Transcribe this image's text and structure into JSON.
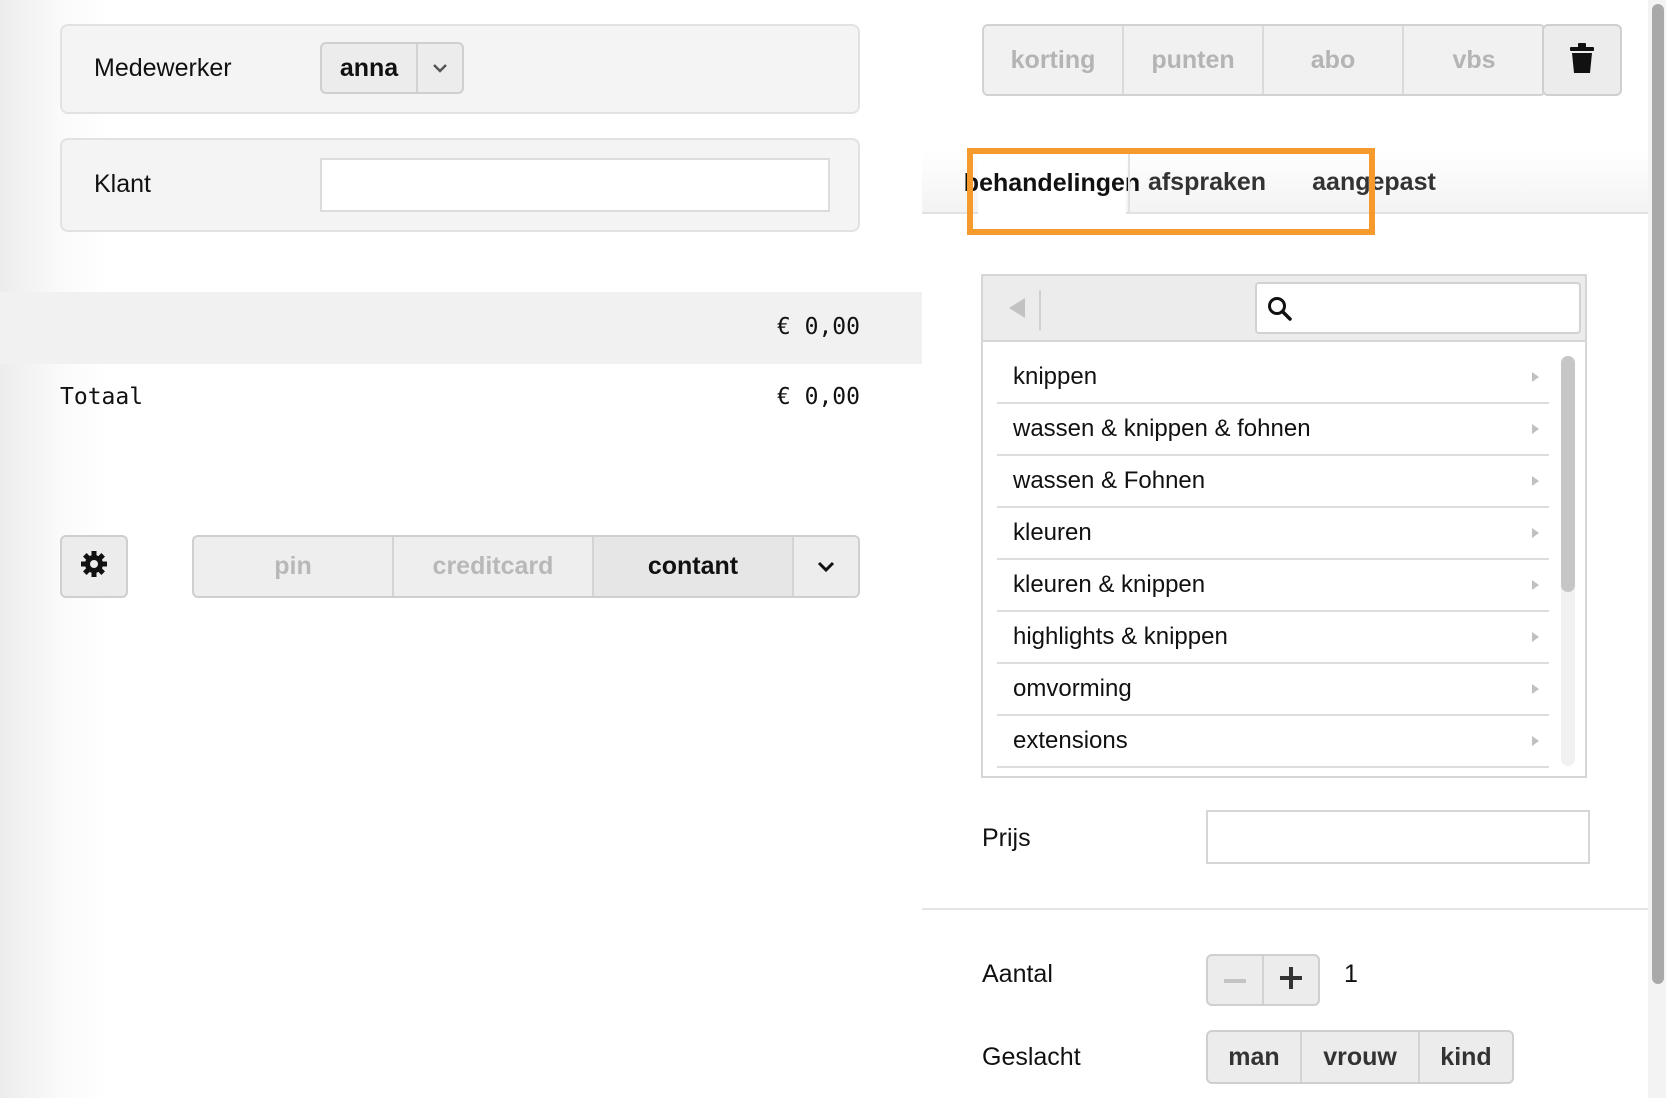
{
  "employee": {
    "label": "Medewerker",
    "value": "anna"
  },
  "customer": {
    "label": "Klant",
    "value": "",
    "placeholder": ""
  },
  "subtotal": {
    "value": "€ 0,00"
  },
  "total": {
    "label": "Totaal",
    "value": "€ 0,00"
  },
  "payment": {
    "options": [
      "pin",
      "creditcard",
      "contant"
    ],
    "selected": "contant"
  },
  "adjustments": {
    "options": [
      "korting",
      "punten",
      "abo",
      "vbs"
    ]
  },
  "tabs": [
    {
      "label": "behandelingen",
      "active": true
    },
    {
      "label": "afspraken",
      "active": false
    },
    {
      "label": "aangepast",
      "active": false
    }
  ],
  "search": {
    "value": "",
    "placeholder": ""
  },
  "treatments": [
    "knippen",
    "wassen & knippen & fohnen",
    "wassen & Fohnen",
    "kleuren",
    "kleuren & knippen",
    "highlights & knippen",
    "omvorming",
    "extensions"
  ],
  "price": {
    "label": "Prijs",
    "value": ""
  },
  "quantity": {
    "label": "Aantal",
    "value": "1"
  },
  "gender": {
    "label": "Geslacht",
    "options": [
      "man",
      "vrouw",
      "kind"
    ]
  },
  "colors": {
    "highlight": "#f79a2e",
    "panel": "#f4f4f4",
    "border": "#cfcfcf"
  },
  "icons": [
    "chevron-down-icon",
    "gear-icon",
    "trash-icon",
    "back-arrow-icon",
    "search-icon",
    "minus-icon",
    "plus-icon",
    "chevron-right-icon"
  ]
}
